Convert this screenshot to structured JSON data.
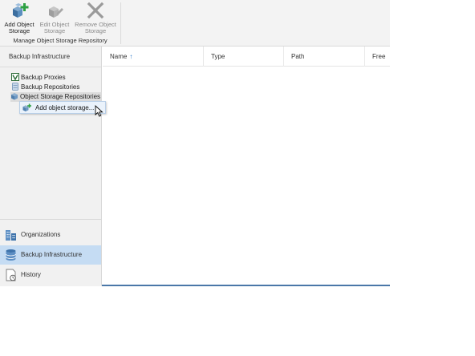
{
  "ribbon": {
    "buttons": [
      {
        "label": "Add Object\nStorage",
        "icon": "add-object-storage-icon",
        "enabled": true
      },
      {
        "label": "Edit Object\nStorage",
        "icon": "edit-object-storage-icon",
        "enabled": false
      },
      {
        "label": "Remove Object\nStorage",
        "icon": "remove-icon",
        "enabled": false
      }
    ],
    "group_label": "Manage Object Storage Repository"
  },
  "left_panel": {
    "header": "Backup Infrastructure",
    "tree": [
      {
        "label": "Backup Proxies",
        "icon": "proxy-icon"
      },
      {
        "label": "Backup Repositories",
        "icon": "repository-icon"
      },
      {
        "label": "Object Storage Repositories",
        "icon": "object-storage-icon",
        "selected": true
      }
    ],
    "context_menu": {
      "label": "Add object storage...",
      "icon": "add-object-storage-icon"
    },
    "nav": [
      {
        "label": "Organizations",
        "icon": "organizations-icon"
      },
      {
        "label": "Backup Infrastructure",
        "icon": "database-icon",
        "active": true
      },
      {
        "label": "History",
        "icon": "history-icon"
      }
    ]
  },
  "table": {
    "columns": [
      "Name",
      "Type",
      "Path",
      "Free"
    ],
    "sort_indicator": "↑",
    "rows": []
  },
  "colors": {
    "accent": "#1f6fc5",
    "nav_active_bg": "#c5dcf3",
    "ribbon_bg": "#f3f3f3",
    "panel_bg": "#f1f1f1"
  }
}
